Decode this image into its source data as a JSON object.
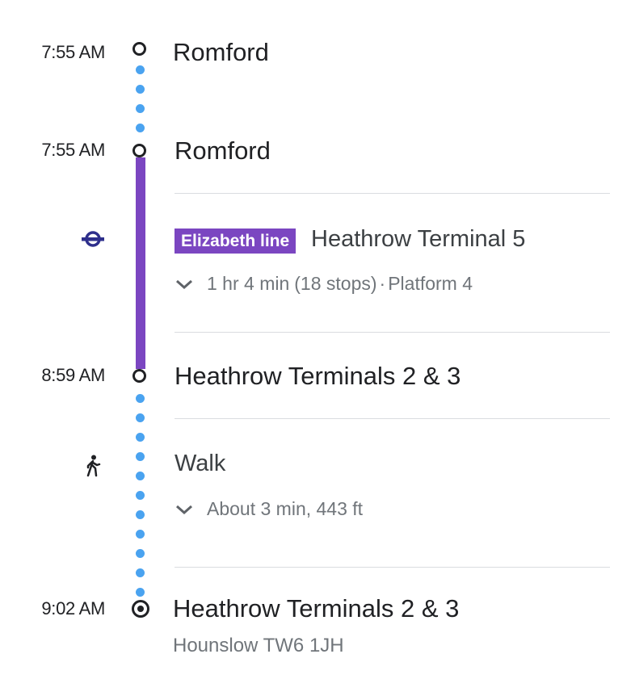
{
  "stops": [
    {
      "time": "7:55 AM",
      "name": "Romford"
    },
    {
      "time": "7:55 AM",
      "name": "Romford"
    },
    {
      "time": "8:59 AM",
      "name": "Heathrow Terminals 2 & 3"
    },
    {
      "time": "9:02 AM",
      "name": "Heathrow Terminals 2 & 3",
      "address": "Hounslow TW6 1JH"
    }
  ],
  "transit": {
    "icon": "underground-roundel-icon",
    "line_badge": "Elizabeth line",
    "line_color": "#7b46c1",
    "headsign": "Heathrow Terminal 5",
    "duration": "1 hr 4 min",
    "stops_count": "(18 stops)",
    "separator": "·",
    "platform": "Platform 4"
  },
  "walk": {
    "icon": "walk-icon",
    "label": "Walk",
    "details": "About 3 min, 443 ft"
  },
  "colors": {
    "walk_dots": "#4aa3f0",
    "text_primary": "#202124",
    "text_secondary": "#70757a",
    "tube_roundel": "#2e2f8c"
  }
}
